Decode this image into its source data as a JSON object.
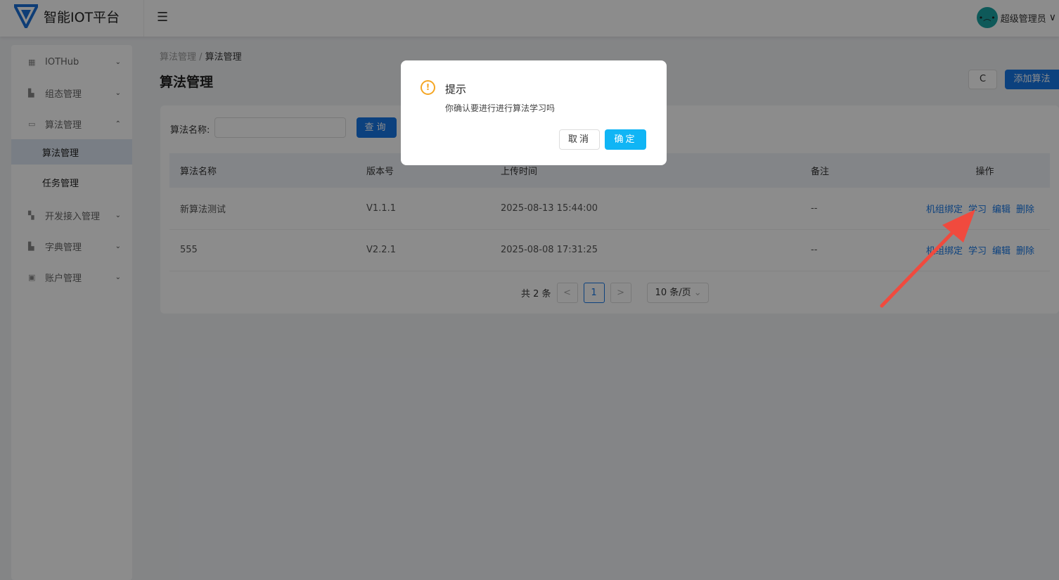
{
  "header": {
    "app_title": "智能IOT平台",
    "user_name": "超级管理员"
  },
  "sidebar": {
    "items": [
      {
        "label": "IOTHub",
        "icon": "grid-icon"
      },
      {
        "label": "组态管理",
        "icon": "config-icon"
      },
      {
        "label": "算法管理",
        "icon": "code-icon",
        "expanded": true,
        "children": [
          {
            "label": "算法管理",
            "active": true
          },
          {
            "label": "任务管理"
          }
        ]
      },
      {
        "label": "开发接入管理",
        "icon": "dev-icon"
      },
      {
        "label": "字典管理",
        "icon": "book-icon"
      },
      {
        "label": "账户管理",
        "icon": "account-icon"
      }
    ]
  },
  "breadcrumb": [
    "算法管理",
    "算法管理"
  ],
  "page_title": "算法管理",
  "toolbar": {
    "refresh": "C",
    "add": "添加算法"
  },
  "search": {
    "label": "算法名称:",
    "value": "",
    "query": "查询"
  },
  "table": {
    "columns": [
      "算法名称",
      "版本号",
      "上传时间",
      "备注",
      "操作"
    ],
    "rows": [
      {
        "name": "新算法测试",
        "version": "V1.1.1",
        "time": "2025-08-13 15:44:00",
        "note": "--"
      },
      {
        "name": "555",
        "version": "V2.2.1",
        "time": "2025-08-08 17:31:25",
        "note": "--"
      }
    ],
    "actions": [
      "机组绑定",
      "学习",
      "编辑",
      "删除"
    ]
  },
  "pagination": {
    "total": "共 2 条",
    "prev": "<",
    "page": "1",
    "next": ">",
    "page_size": "10 条/页"
  },
  "dialog": {
    "title": "提示",
    "message": "你确认要进行进行算法学习吗",
    "cancel": "取消",
    "confirm": "确定",
    "icon": "!"
  },
  "colors": {
    "primary": "#1677e6",
    "confirm": "#10b5f5",
    "warning": "#f5a623",
    "arrow": "#f04a3e"
  }
}
